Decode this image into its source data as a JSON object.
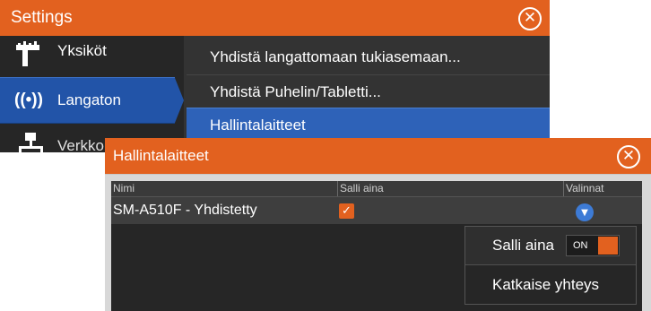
{
  "settings_window": {
    "title": "Settings",
    "close_icon": "close-circle-icon",
    "sidebar": {
      "items": [
        {
          "label": "Yksiköt",
          "icon": "units-ruler-icon"
        },
        {
          "label": "Langaton",
          "icon": "wireless-icon",
          "selected": true
        },
        {
          "label": "Verkko",
          "icon": "network-icon"
        }
      ]
    },
    "list": {
      "items": [
        {
          "label": "Yhdistä langattomaan tukiasemaan..."
        },
        {
          "label": "Yhdistä Puhelin/Tabletti..."
        },
        {
          "label": "Hallintalaitteet",
          "selected": true
        }
      ]
    }
  },
  "dialog": {
    "title": "Hallintalaitteet",
    "close_icon": "close-circle-icon",
    "table": {
      "headers": [
        "Nimi",
        "Salli aina",
        "Valinnat"
      ],
      "rows": [
        {
          "name": "SM-A510F - Yhdistetty",
          "allow_always": true,
          "options_icon": "chevron-down-icon"
        }
      ]
    }
  },
  "popup_menu": {
    "items": [
      {
        "label": "Salli aina",
        "toggle_text": "ON",
        "toggle_on": true
      },
      {
        "label": "Katkaise yhteys"
      }
    ]
  },
  "colors": {
    "accent_orange": "#e2611f",
    "selection_blue": "#2254a8",
    "panel_dark": "#2b2b2b"
  }
}
